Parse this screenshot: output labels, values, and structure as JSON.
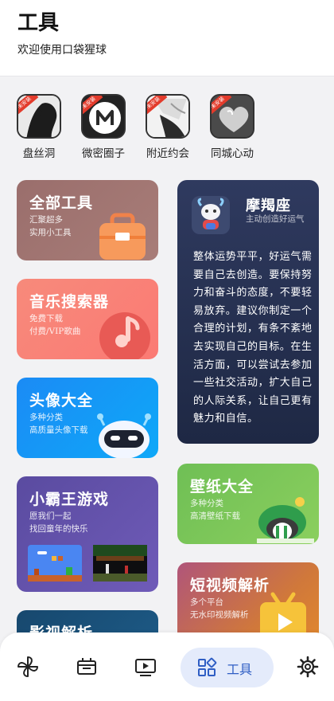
{
  "header": {
    "title": "工具",
    "subtitle": "欢迎使用口袋猩球"
  },
  "apps": [
    {
      "label": "盘丝洞",
      "badge": "未安装"
    },
    {
      "label": "微密圈子",
      "badge": "未安装"
    },
    {
      "label": "附近约会",
      "badge": "未安装"
    },
    {
      "label": "同城心动",
      "badge": "未安装"
    }
  ],
  "cards": {
    "all_tools": {
      "title": "全部工具",
      "desc1": "汇聚超多",
      "desc2": "实用小工具"
    },
    "music": {
      "title": "音乐搜索器",
      "desc1": "免费下载",
      "desc2": "付费/VIP歌曲"
    },
    "avatar": {
      "title": "头像大全",
      "desc1": "多种分类",
      "desc2": "高质量头像下载"
    },
    "game": {
      "title": "小霸王游戏",
      "desc1": "愿我们一起",
      "desc2": "找回童年的快乐"
    },
    "video": {
      "title": "影视解析"
    },
    "horoscope": {
      "title": "摩羯座",
      "subtitle": "主动创造好运气",
      "body": "整体运势平平，好运气需要自己去创造。要保持努力和奋斗的态度，不要轻易放弃。建议你制定一个合理的计划，有条不紊地去实现自己的目标。在生活方面，可以尝试去参加一些社交活动，扩大自己的人际关系，让自己更有魅力和自信。"
    },
    "wallpaper": {
      "title": "壁纸大全",
      "desc1": "多种分类",
      "desc2": "高清壁纸下载"
    },
    "short_video": {
      "title": "短视频解析",
      "desc1": "多个平台",
      "desc2": "无水印视频解析"
    }
  },
  "bottom_nav": {
    "items": [
      "pinwheel-icon",
      "ticket-icon",
      "play-screen-icon",
      "grid-icon",
      "gear-icon"
    ],
    "active_label": "工具",
    "active_color": "#2f5ec4"
  }
}
